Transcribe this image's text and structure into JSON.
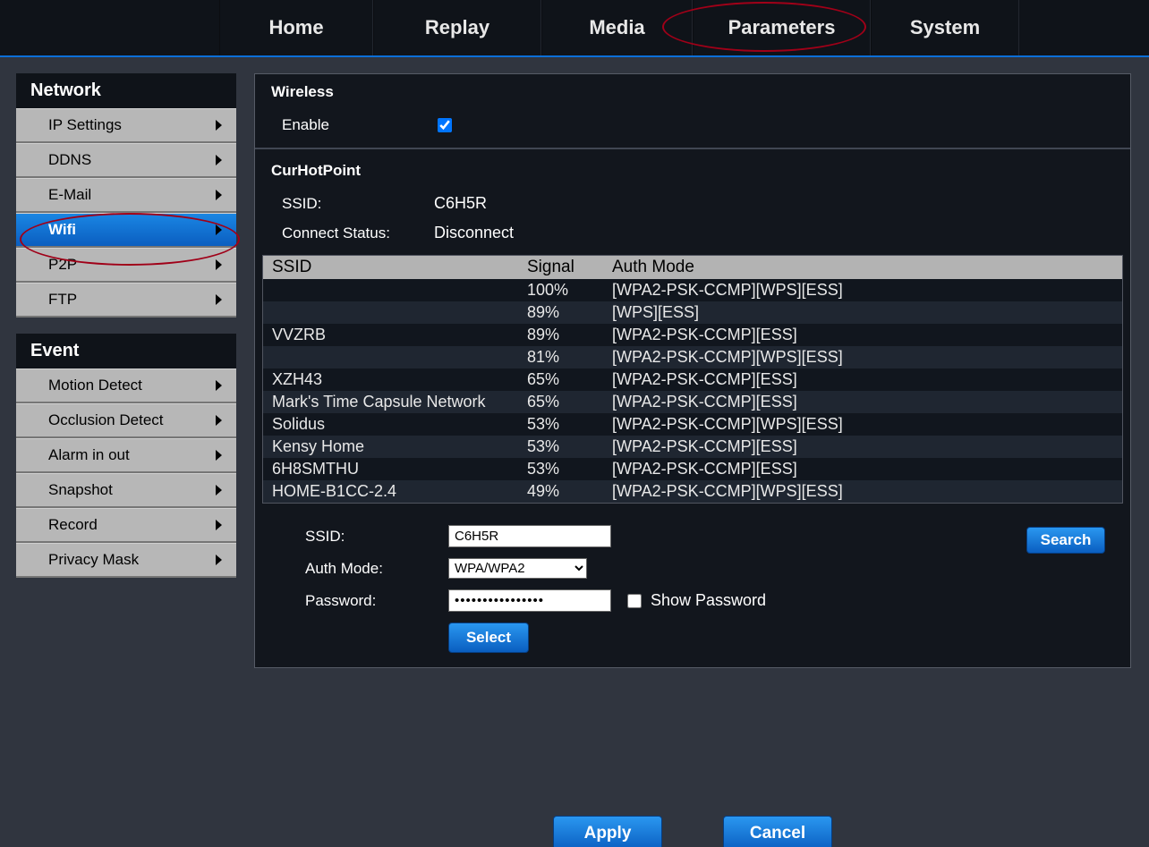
{
  "topnav": [
    "Home",
    "Replay",
    "Media",
    "Parameters",
    "System"
  ],
  "topnav_widths": [
    170,
    186,
    167,
    197,
    164
  ],
  "sidebar": {
    "cat1": "Network",
    "items1": [
      "IP Settings",
      "DDNS",
      "E-Mail",
      "Wifi",
      "P2P",
      "FTP"
    ],
    "active1": 3,
    "cat2": "Event",
    "items2": [
      "Motion Detect",
      "Occlusion Detect",
      "Alarm in out",
      "Snapshot",
      "Record",
      "Privacy Mask"
    ]
  },
  "wireless": {
    "title": "Wireless",
    "enable_label": "Enable",
    "enable_checked": true
  },
  "curhot": {
    "title": "CurHotPoint",
    "ssid_label": "SSID:",
    "ssid_value": "C6H5R",
    "status_label": "Connect Status:",
    "status_value": "Disconnect"
  },
  "grid": {
    "headers": [
      "SSID",
      "Signal",
      "Auth Mode"
    ],
    "rows": [
      {
        "ssid": "",
        "signal": "100%",
        "auth": "[WPA2-PSK-CCMP][WPS][ESS]"
      },
      {
        "ssid": "",
        "signal": "89%",
        "auth": "[WPS][ESS]"
      },
      {
        "ssid": "VVZRB",
        "signal": "89%",
        "auth": "[WPA2-PSK-CCMP][ESS]"
      },
      {
        "ssid": "",
        "signal": "81%",
        "auth": "[WPA2-PSK-CCMP][WPS][ESS]"
      },
      {
        "ssid": "XZH43",
        "signal": "65%",
        "auth": "[WPA2-PSK-CCMP][ESS]"
      },
      {
        "ssid": "Mark's Time Capsule Network",
        "signal": "65%",
        "auth": "[WPA2-PSK-CCMP][ESS]"
      },
      {
        "ssid": "Solidus",
        "signal": "53%",
        "auth": "[WPA2-PSK-CCMP][WPS][ESS]"
      },
      {
        "ssid": "Kensy Home",
        "signal": "53%",
        "auth": "[WPA2-PSK-CCMP][ESS]"
      },
      {
        "ssid": "6H8SMTHU",
        "signal": "53%",
        "auth": "[WPA2-PSK-CCMP][ESS]"
      },
      {
        "ssid": "HOME-B1CC-2.4",
        "signal": "49%",
        "auth": "[WPA2-PSK-CCMP][WPS][ESS]"
      }
    ]
  },
  "conn": {
    "ssid_label": "SSID:",
    "ssid_value": "C6H5R",
    "auth_label": "Auth Mode:",
    "auth_value": "WPA/WPA2",
    "pass_label": "Password:",
    "pass_value": "••••••••••••••••",
    "show_label": "Show Password",
    "search": "Search",
    "select": "Select"
  },
  "footer": {
    "apply": "Apply",
    "cancel": "Cancel"
  }
}
